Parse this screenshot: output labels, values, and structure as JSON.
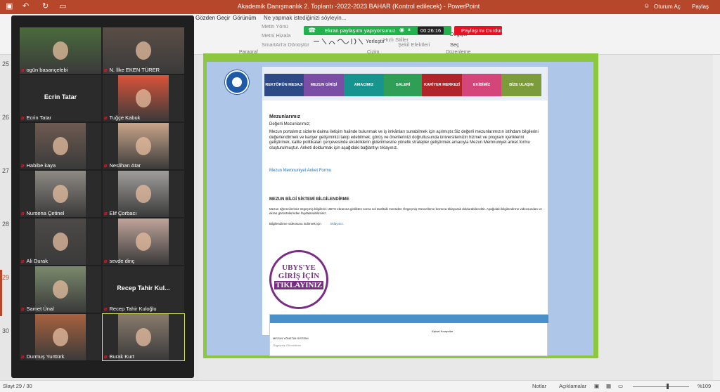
{
  "titlebar": {
    "title": "Akademik Danışmanlık 2. Toplantı -2022-2023 BAHAR (Kontrol edilecek) - PowerPoint",
    "signin": "Oturum Aç",
    "share": "Paylaş"
  },
  "ribbon": {
    "tabs": [
      "Gözden Geçir",
      "Görünüm",
      "Ne yapmak istediğinizi söyleyin..."
    ],
    "items": [
      "Metin Yönü",
      "Metni Hizala",
      "SmartArt'a Dönüştür",
      "Yerleştir",
      "Hızlı Stiller",
      "Şekil Efektleri",
      "Değiştir",
      "Seç"
    ],
    "groups": [
      "Paragraf",
      "Çizim",
      "Düzenleme"
    ]
  },
  "share": {
    "label": "Ekran paylaşımı yapıyorsunuz",
    "timer": "00:26:16",
    "stop": "Paylaşımı Durdur"
  },
  "slides": {
    "numbers": [
      "25",
      "26",
      "27",
      "28",
      "29",
      "30"
    ],
    "current": "29"
  },
  "status": {
    "slide": "Slayt 29 / 30",
    "notes": "Notlar",
    "comments": "Açıklamalar",
    "zoom": "%109"
  },
  "participants": [
    {
      "name": "ogün basançelebi",
      "color": "#4a6b3c"
    },
    {
      "name": "N. İlke EKEN TÜRER",
      "color": "#5a4e46"
    },
    {
      "name": "Ecrin Tatar",
      "big": "Ecrin Tatar"
    },
    {
      "name": "Tuğçe Kabuk",
      "color": "#d9533a"
    },
    {
      "name": "Habibe kaya",
      "color": "#6d5a50"
    },
    {
      "name": "Neslihan Atar",
      "color": "#c9a58a"
    },
    {
      "name": "Nursena Çetinel",
      "color": "#8e8a84"
    },
    {
      "name": "Elif Çorbacı",
      "color": "#a09e9c"
    },
    {
      "name": "Ali Durak",
      "color": "#4d4a48"
    },
    {
      "name": "sevde dinç",
      "color": "#bfa49a"
    },
    {
      "name": "Samet Ünal",
      "color": "#7a8a6c"
    },
    {
      "name": "Recep Tahir Kuloğlu",
      "big": "Recep Tahir Kul..."
    },
    {
      "name": "Durmuş Yurttürk",
      "color": "#a8623e"
    },
    {
      "name": "Burak Kurt",
      "color": "#8a7b6c"
    }
  ],
  "web": {
    "nav": [
      {
        "label": "REKTÖRÜN MESAJI",
        "color": "#2e4a86"
      },
      {
        "label": "MEZUN GİRİŞİ",
        "color": "#7b4ea6"
      },
      {
        "label": "AMACIMIZ",
        "color": "#18948e"
      },
      {
        "label": "GALERİ",
        "color": "#2f9e57"
      },
      {
        "label": "KARİYER MERKEZİ",
        "color": "#b0252a"
      },
      {
        "label": "EKİBİMİZ",
        "color": "#d4457a"
      },
      {
        "label": "BİZE ULAŞIN",
        "color": "#7c9c3c"
      }
    ],
    "heading": "Mezunlarımız",
    "greeting": "Değerli Mezunlarımız;",
    "para": "Mezun portalımız sizlerle daima iletişim halinde bulunmak ve iş imkânları sunabilmek için açılmıştır.Siz değerli mezunlarımızın istihdam bilgilerini değerlendirmek ve kariyer gelişiminizi takip edebilmek; görüş ve önerilerinizi doğrultusunda üniversitemizin hizmet ve program içeriklerini geliştirmek, kalite politikaları çerçevesinde eksikliklerin giderilmesine yönelik stratejiler geliştirmek amacıyla Mezun Memnuniyet anket formu oluşturulmuştur.  Anketi doldurmak için aşağıdaki bağlantıyı tıklayınız.",
    "link": "Mezun Memnuniyet Anket Formu",
    "h2": "MEZUN BİLGİ SİSTEMİ BİLGİLENDİRME",
    "p2": "Mezun öğrencilerimiz özgeçmiş bilgilerini UBYS ekranına girdikten sonra sol taraftaki menüden Özgeçmiş Güncelleme kısmına tıklayarak doldurabilecektir. Aşağıdaki bilgilendirme videosundan ve ekran görüntülerinden faydalanabilirsiniz.",
    "p3": "Bilgilendirme videosunu indirmek için",
    "p3link": "tıklayınız.",
    "ubys1": "UBYS'YE",
    "ubys2": "GİRİŞ İÇİN",
    "ubys3": "TIKLAYINIZ",
    "shot": [
      "MEZUN YÖNETİM SİSTEMİ",
      "Özgeçmiş Güncelleme",
      "Kişisel Kısayollar"
    ]
  }
}
